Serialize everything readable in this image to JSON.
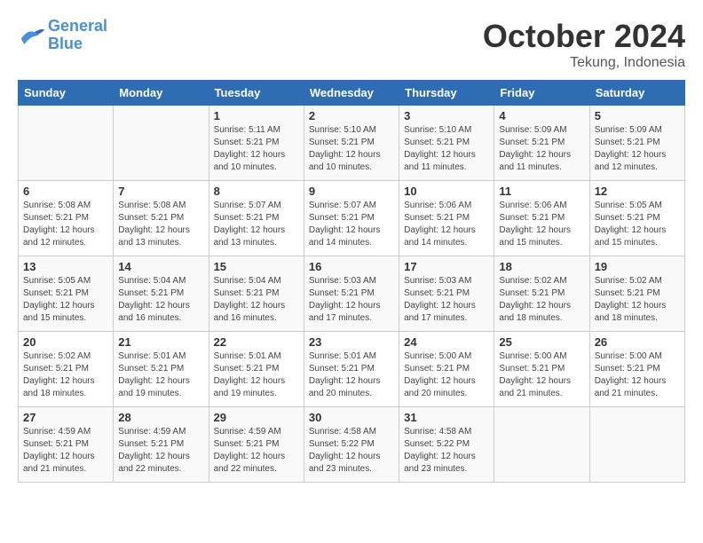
{
  "logo": {
    "text_general": "General",
    "text_blue": "Blue"
  },
  "header": {
    "month": "October 2024",
    "location": "Tekung, Indonesia"
  },
  "days_of_week": [
    "Sunday",
    "Monday",
    "Tuesday",
    "Wednesday",
    "Thursday",
    "Friday",
    "Saturday"
  ],
  "weeks": [
    [
      {
        "day": "",
        "sunrise": "",
        "sunset": "",
        "daylight": ""
      },
      {
        "day": "",
        "sunrise": "",
        "sunset": "",
        "daylight": ""
      },
      {
        "day": "1",
        "sunrise": "Sunrise: 5:11 AM",
        "sunset": "Sunset: 5:21 PM",
        "daylight": "Daylight: 12 hours and 10 minutes."
      },
      {
        "day": "2",
        "sunrise": "Sunrise: 5:10 AM",
        "sunset": "Sunset: 5:21 PM",
        "daylight": "Daylight: 12 hours and 10 minutes."
      },
      {
        "day": "3",
        "sunrise": "Sunrise: 5:10 AM",
        "sunset": "Sunset: 5:21 PM",
        "daylight": "Daylight: 12 hours and 11 minutes."
      },
      {
        "day": "4",
        "sunrise": "Sunrise: 5:09 AM",
        "sunset": "Sunset: 5:21 PM",
        "daylight": "Daylight: 12 hours and 11 minutes."
      },
      {
        "day": "5",
        "sunrise": "Sunrise: 5:09 AM",
        "sunset": "Sunset: 5:21 PM",
        "daylight": "Daylight: 12 hours and 12 minutes."
      }
    ],
    [
      {
        "day": "6",
        "sunrise": "Sunrise: 5:08 AM",
        "sunset": "Sunset: 5:21 PM",
        "daylight": "Daylight: 12 hours and 12 minutes."
      },
      {
        "day": "7",
        "sunrise": "Sunrise: 5:08 AM",
        "sunset": "Sunset: 5:21 PM",
        "daylight": "Daylight: 12 hours and 13 minutes."
      },
      {
        "day": "8",
        "sunrise": "Sunrise: 5:07 AM",
        "sunset": "Sunset: 5:21 PM",
        "daylight": "Daylight: 12 hours and 13 minutes."
      },
      {
        "day": "9",
        "sunrise": "Sunrise: 5:07 AM",
        "sunset": "Sunset: 5:21 PM",
        "daylight": "Daylight: 12 hours and 14 minutes."
      },
      {
        "day": "10",
        "sunrise": "Sunrise: 5:06 AM",
        "sunset": "Sunset: 5:21 PM",
        "daylight": "Daylight: 12 hours and 14 minutes."
      },
      {
        "day": "11",
        "sunrise": "Sunrise: 5:06 AM",
        "sunset": "Sunset: 5:21 PM",
        "daylight": "Daylight: 12 hours and 15 minutes."
      },
      {
        "day": "12",
        "sunrise": "Sunrise: 5:05 AM",
        "sunset": "Sunset: 5:21 PM",
        "daylight": "Daylight: 12 hours and 15 minutes."
      }
    ],
    [
      {
        "day": "13",
        "sunrise": "Sunrise: 5:05 AM",
        "sunset": "Sunset: 5:21 PM",
        "daylight": "Daylight: 12 hours and 15 minutes."
      },
      {
        "day": "14",
        "sunrise": "Sunrise: 5:04 AM",
        "sunset": "Sunset: 5:21 PM",
        "daylight": "Daylight: 12 hours and 16 minutes."
      },
      {
        "day": "15",
        "sunrise": "Sunrise: 5:04 AM",
        "sunset": "Sunset: 5:21 PM",
        "daylight": "Daylight: 12 hours and 16 minutes."
      },
      {
        "day": "16",
        "sunrise": "Sunrise: 5:03 AM",
        "sunset": "Sunset: 5:21 PM",
        "daylight": "Daylight: 12 hours and 17 minutes."
      },
      {
        "day": "17",
        "sunrise": "Sunrise: 5:03 AM",
        "sunset": "Sunset: 5:21 PM",
        "daylight": "Daylight: 12 hours and 17 minutes."
      },
      {
        "day": "18",
        "sunrise": "Sunrise: 5:02 AM",
        "sunset": "Sunset: 5:21 PM",
        "daylight": "Daylight: 12 hours and 18 minutes."
      },
      {
        "day": "19",
        "sunrise": "Sunrise: 5:02 AM",
        "sunset": "Sunset: 5:21 PM",
        "daylight": "Daylight: 12 hours and 18 minutes."
      }
    ],
    [
      {
        "day": "20",
        "sunrise": "Sunrise: 5:02 AM",
        "sunset": "Sunset: 5:21 PM",
        "daylight": "Daylight: 12 hours and 18 minutes."
      },
      {
        "day": "21",
        "sunrise": "Sunrise: 5:01 AM",
        "sunset": "Sunset: 5:21 PM",
        "daylight": "Daylight: 12 hours and 19 minutes."
      },
      {
        "day": "22",
        "sunrise": "Sunrise: 5:01 AM",
        "sunset": "Sunset: 5:21 PM",
        "daylight": "Daylight: 12 hours and 19 minutes."
      },
      {
        "day": "23",
        "sunrise": "Sunrise: 5:01 AM",
        "sunset": "Sunset: 5:21 PM",
        "daylight": "Daylight: 12 hours and 20 minutes."
      },
      {
        "day": "24",
        "sunrise": "Sunrise: 5:00 AM",
        "sunset": "Sunset: 5:21 PM",
        "daylight": "Daylight: 12 hours and 20 minutes."
      },
      {
        "day": "25",
        "sunrise": "Sunrise: 5:00 AM",
        "sunset": "Sunset: 5:21 PM",
        "daylight": "Daylight: 12 hours and 21 minutes."
      },
      {
        "day": "26",
        "sunrise": "Sunrise: 5:00 AM",
        "sunset": "Sunset: 5:21 PM",
        "daylight": "Daylight: 12 hours and 21 minutes."
      }
    ],
    [
      {
        "day": "27",
        "sunrise": "Sunrise: 4:59 AM",
        "sunset": "Sunset: 5:21 PM",
        "daylight": "Daylight: 12 hours and 21 minutes."
      },
      {
        "day": "28",
        "sunrise": "Sunrise: 4:59 AM",
        "sunset": "Sunset: 5:21 PM",
        "daylight": "Daylight: 12 hours and 22 minutes."
      },
      {
        "day": "29",
        "sunrise": "Sunrise: 4:59 AM",
        "sunset": "Sunset: 5:21 PM",
        "daylight": "Daylight: 12 hours and 22 minutes."
      },
      {
        "day": "30",
        "sunrise": "Sunrise: 4:58 AM",
        "sunset": "Sunset: 5:22 PM",
        "daylight": "Daylight: 12 hours and 23 minutes."
      },
      {
        "day": "31",
        "sunrise": "Sunrise: 4:58 AM",
        "sunset": "Sunset: 5:22 PM",
        "daylight": "Daylight: 12 hours and 23 minutes."
      },
      {
        "day": "",
        "sunrise": "",
        "sunset": "",
        "daylight": ""
      },
      {
        "day": "",
        "sunrise": "",
        "sunset": "",
        "daylight": ""
      }
    ]
  ]
}
